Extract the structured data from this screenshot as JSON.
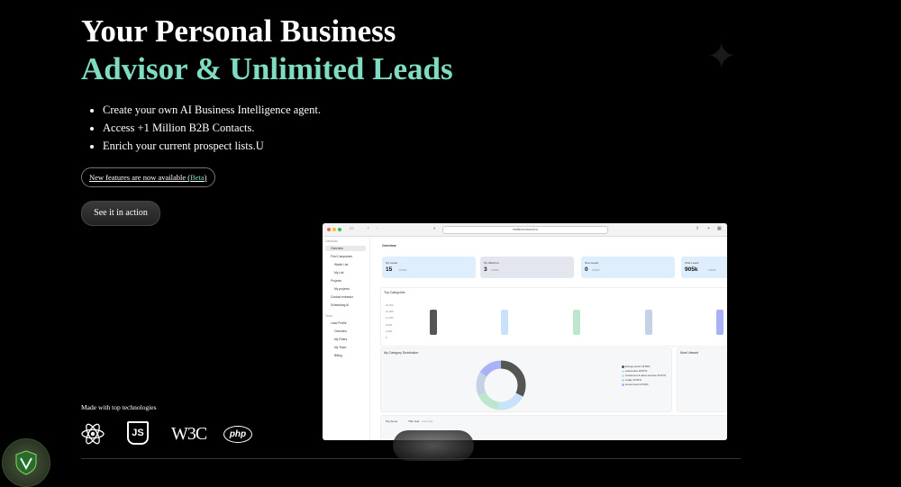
{
  "hero": {
    "title_line1": "Your Personal Business",
    "title_line2": "Advisor & Unlimited Leads",
    "bullets": [
      "Create your own AI Business Intelligence agent.",
      "Access +1 Million B2B Contacts.",
      "Enrich your current prospect lists.U"
    ],
    "pill_text": "New features are now available (",
    "pill_beta": "Beta",
    "pill_close": ")",
    "cta_label": "See it in action"
  },
  "tech": {
    "heading": "Made with top technologies",
    "icons": [
      "react-icon",
      "js-icon",
      "w3c-icon",
      "php-icon"
    ],
    "w3c_text": "W3C",
    "php_text": "php",
    "js_text": "JS"
  },
  "app": {
    "url": "realtimenetwork.io",
    "sidebar": {
      "section1": "Database",
      "items": [
        "Overview",
        "Find Companies",
        "Watch List",
        "My List",
        "Projects",
        "My projects",
        "Contact extractor",
        "Scheduling AI"
      ],
      "section2": "Team",
      "items2": [
        "Lead Profile",
        "Overview",
        "My Filters",
        "My Team",
        "Billing"
      ]
    },
    "page_title": "Overview",
    "stats": [
      {
        "label": "My Leads",
        "value": "15",
        "change": "0.00%"
      },
      {
        "label": "My Watched",
        "value": "3",
        "change": "0.00%"
      },
      {
        "label": "New Leads",
        "value": "0",
        "change": "0.00%"
      },
      {
        "label": "Total Leads",
        "value": "905k",
        "change": "0.00%"
      }
    ],
    "top_categories": {
      "title": "Top Categories",
      "yticks": [
        "20,000",
        "16,000",
        "12,000",
        "8,000",
        "4,000",
        "0"
      ]
    },
    "distribution": {
      "title": "My Category Distribution",
      "legend": [
        "Energy sector 32.50%",
        "Automotive 18.87%",
        "Investment & asset services 16.67%",
        "Lodge 10.51%",
        "Government 10.61%"
      ]
    },
    "most_viewed": "Most Viewed",
    "top_items": {
      "title": "Top Items",
      "tab1": "This Year",
      "tab2": "Last Year"
    }
  },
  "colors": {
    "accent": "#7fdcc3",
    "background": "#000000"
  }
}
